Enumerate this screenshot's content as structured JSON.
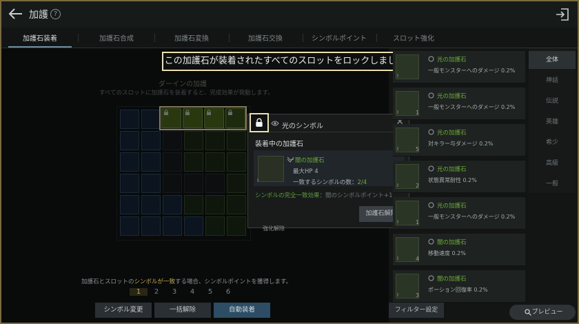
{
  "header": {
    "title": "加護",
    "help_label": "?"
  },
  "tabs": [
    {
      "label": "加護石装着"
    },
    {
      "label": "加護石合成"
    },
    {
      "label": "加護石変換"
    },
    {
      "label": "加護石交換"
    },
    {
      "label": "シンボルポイント"
    },
    {
      "label": "スロット強化"
    }
  ],
  "toast": "この加護石が装着されたすべてのスロットをロックしました。",
  "board": {
    "title": "ダーインの加護",
    "description": "すべてのスロットに加護石を装着すると、完成効果が発動します。",
    "locked_lock_label": "1"
  },
  "popup": {
    "title": "光のシンボル",
    "close_label": "✕",
    "subtitle": "装着中の加護石",
    "stone_name": "闇の加護石",
    "stone_level": "I",
    "stat": "最大HP 4",
    "match_prefix": "一致するシンボルの数：",
    "match_value": "2/4",
    "effect_label": "シンボルの完全一致効果：",
    "effect_value": "闇のシンボルポイント+1",
    "release_button": "加護石解除",
    "underlying_button": "強化解除"
  },
  "bottom": {
    "desc_a": "加護石とスロットの",
    "desc_hl": "シンボルが一致",
    "desc_b": "する場合、シンボルポイントを獲得します。",
    "numbers": [
      "1",
      "2",
      "3",
      "4",
      "5",
      "6"
    ],
    "btn_symbol_change": "シンボル変更",
    "btn_release_all": "一括解除",
    "btn_auto_equip": "自動装着"
  },
  "list": [
    {
      "name": "光の加護石",
      "effect": "一般モンスターへのダメージ 0.2%",
      "lv": "I",
      "count": ""
    },
    {
      "name": "光の加護石",
      "effect": "一般モンスターへのダメージ 0.2%",
      "lv": "I",
      "count": "1"
    },
    {
      "name": "光の加護石",
      "effect": "対キラー与ダメージ 0.2%",
      "lv": "I",
      "count": "5"
    },
    {
      "name": "光の加護石",
      "effect": "状態異常耐性 0.2%",
      "lv": "I",
      "count": "2"
    },
    {
      "name": "光の加護石",
      "effect": "一般モンスターへのダメージ 0.2%",
      "lv": "I",
      "count": "1"
    },
    {
      "name": "闇の加護石",
      "effect": "移動速度 0.2%",
      "lv": "I",
      "count": "4"
    },
    {
      "name": "闇の加護石",
      "effect": "ポーション回復率 0.2%",
      "lv": "I",
      "count": "3"
    }
  ],
  "filters": [
    "全体",
    "神話",
    "伝説",
    "英雄",
    "希少",
    "高級",
    "一般"
  ],
  "filter_button": "フィルター設定",
  "preview_button": "プレビュー"
}
